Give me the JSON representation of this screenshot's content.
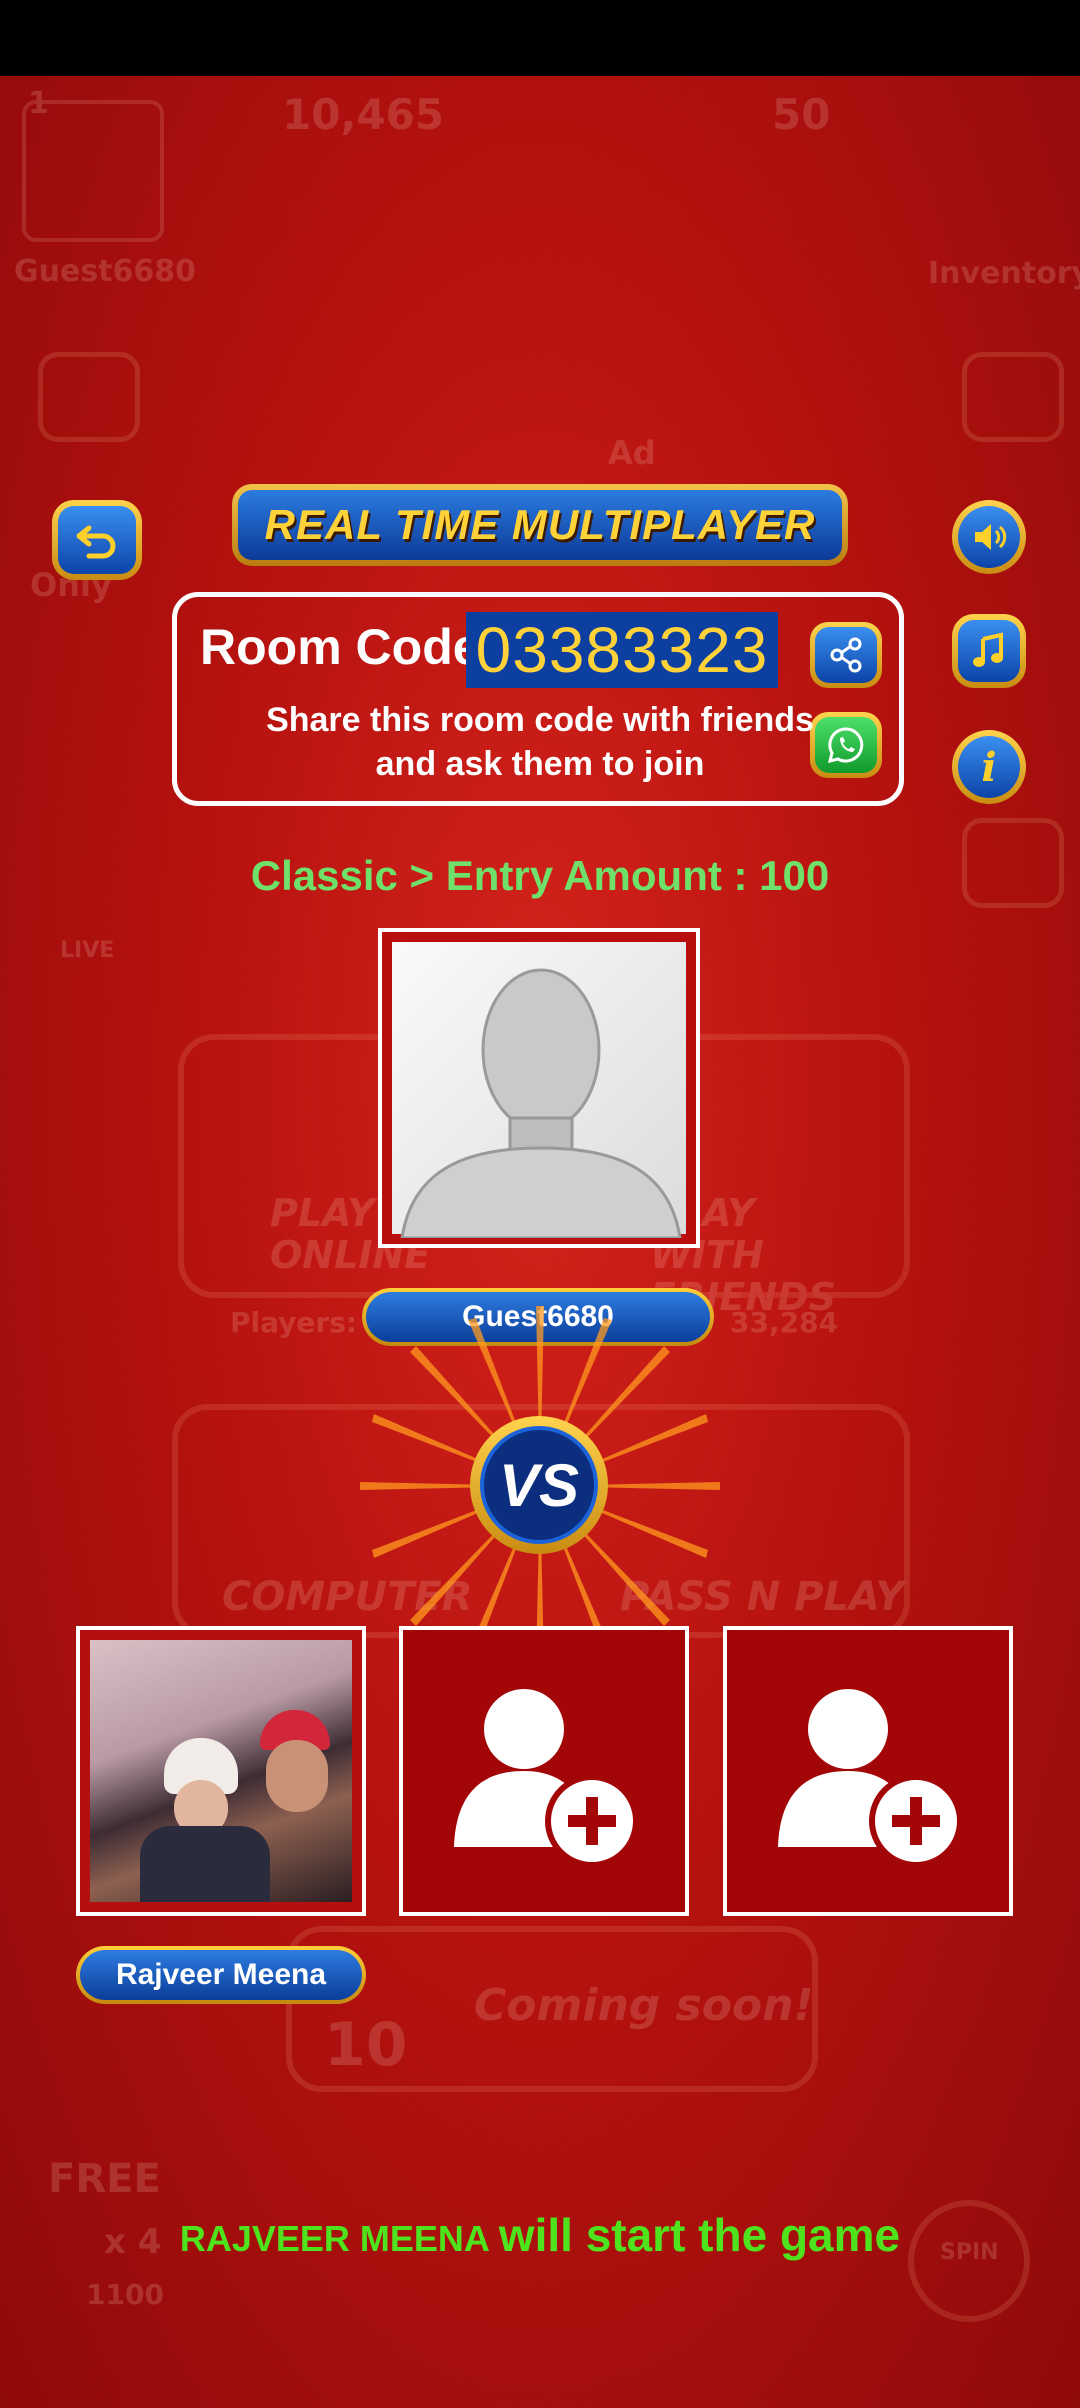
{
  "background_lobby": {
    "player_name": "Guest6680",
    "level": "1",
    "coins": "10,465",
    "gems": "50",
    "inventory_label": "Inventory",
    "ad_label": "Ad",
    "only_label": "Only",
    "live_label": "LIVE",
    "play_online_label": "PLAY ONLINE",
    "play_with_friends_label": "PLAY WITH FRIENDS",
    "players_label": "Players:",
    "players_count": "33,284",
    "computer_label": "COMPUTER",
    "pass_n_play_label": "PASS N PLAY",
    "coming_soon_label": "Coming soon!",
    "season_number": "10",
    "free_label": "FREE",
    "ad_multiplier": "x 4",
    "free_reward": "1100",
    "spin_label": "SPIN"
  },
  "panel": {
    "title": "REAL TIME MULTIPLAYER",
    "room_code_label": "Room Code :",
    "room_code": "03383323",
    "share_text": "Share this room code with friends and ask them to join",
    "entry_text": "Classic > Entry Amount : 100"
  },
  "host": {
    "name": "Guest6680"
  },
  "vs_label": "VS",
  "players": [
    {
      "name": "Rajveer Meena",
      "joined": true
    },
    {
      "joined": false
    },
    {
      "joined": false
    }
  ],
  "start_message": {
    "name": "RAJVEER MEENA",
    "rest": "will start the game"
  },
  "colors": {
    "accent_gold": "#ffd23a",
    "button_blue": "#0c44a8",
    "green_text": "#4ee31c",
    "bg_red": "#b6120f"
  },
  "icons": [
    "back-icon",
    "speaker-icon",
    "music-icon",
    "info-icon",
    "share-icon",
    "whatsapp-icon",
    "add-user-icon"
  ]
}
